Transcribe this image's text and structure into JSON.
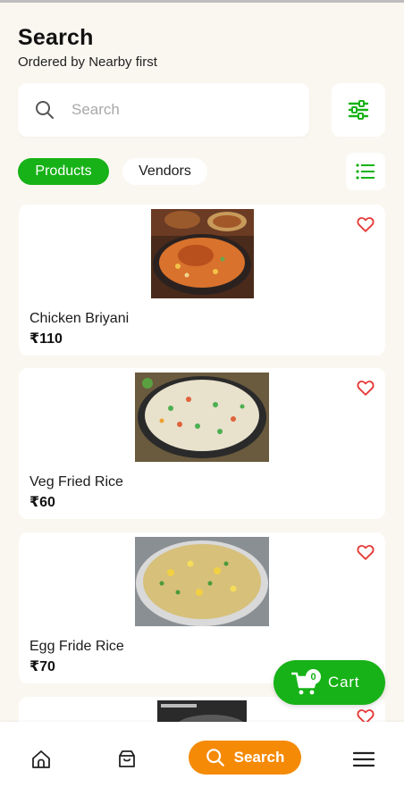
{
  "header": {
    "title": "Search",
    "subtitle": "Ordered by Nearby first"
  },
  "search": {
    "placeholder": "Search",
    "value": ""
  },
  "filter_button": {
    "icon": "sliders-icon"
  },
  "tabs": [
    {
      "label": "Products",
      "active": true
    },
    {
      "label": "Vendors",
      "active": false
    }
  ],
  "view_toggle": {
    "icon": "list-icon"
  },
  "products": [
    {
      "name": "Chicken Briyani",
      "price": "₹110",
      "image": "chicken-biryani-image",
      "favorite": false
    },
    {
      "name": "Veg Fried Rice",
      "price": "₹60",
      "image": "veg-fried-rice-image",
      "favorite": false
    },
    {
      "name": "Egg Fride Rice",
      "price": "₹70",
      "image": "egg-fried-rice-image",
      "favorite": false
    },
    {
      "name": "",
      "price": "",
      "image": "fried-rice-image",
      "favorite": false
    }
  ],
  "cart": {
    "label": "Cart",
    "count": "0"
  },
  "bottom_nav": {
    "home_icon": "home-icon",
    "orders_icon": "orders-box-icon",
    "search_label": "Search",
    "menu_icon": "hamburger-menu-icon"
  },
  "colors": {
    "primary_green": "#17b217",
    "accent_orange": "#f58a07",
    "heart_red": "#e53935",
    "background": "#faf7f0"
  }
}
